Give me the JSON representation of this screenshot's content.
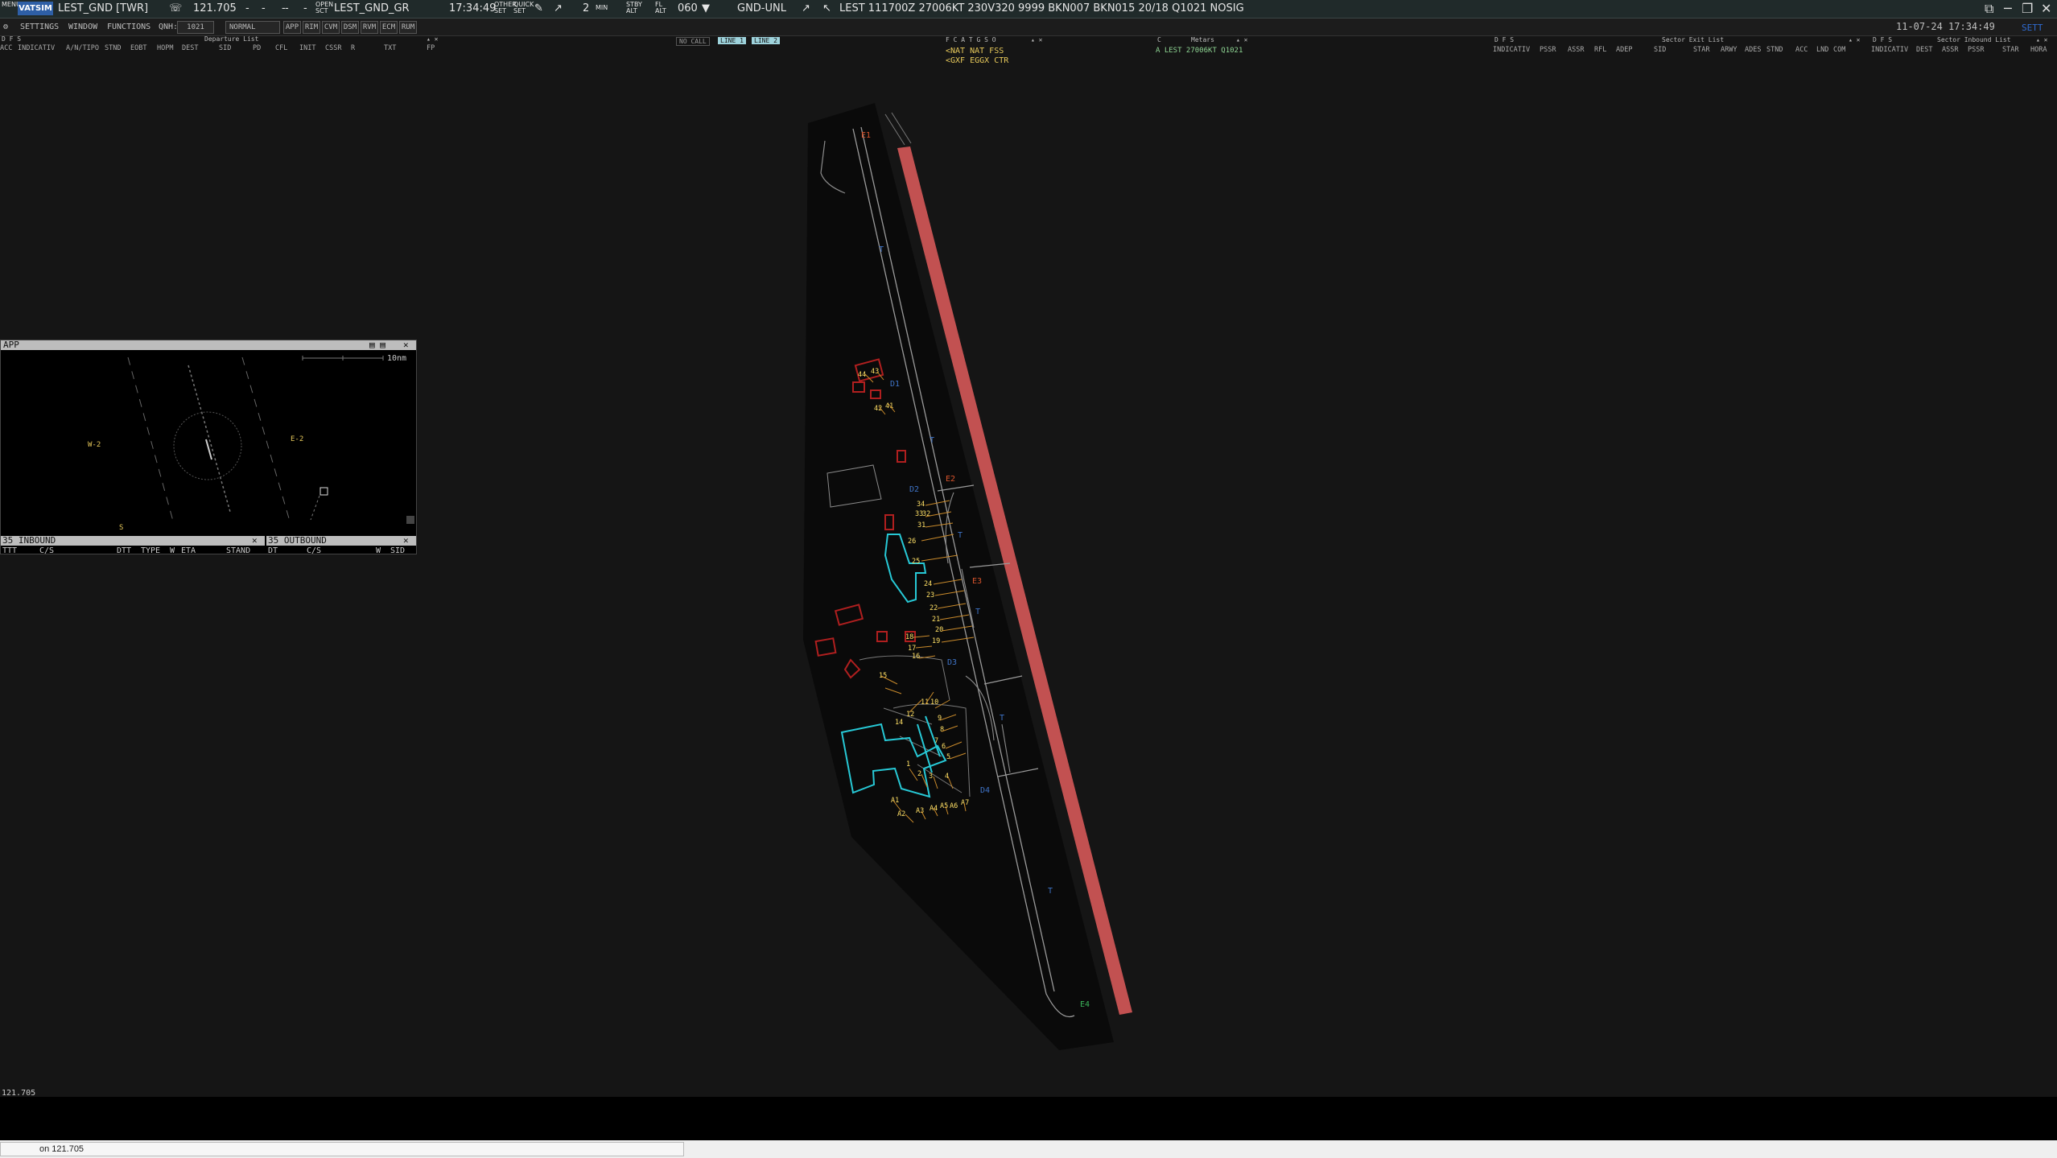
{
  "topbar": {
    "menu_label": "MENU",
    "logo": "VATSIM",
    "callsign": "LEST_GND [TWR]",
    "frequency": "121.705",
    "dashes": [
      "-",
      "-",
      "-",
      "-",
      "-"
    ],
    "open_sct": "OPEN\nSCT",
    "gr_position": "LEST_GND_GR",
    "time": "17:34:49",
    "other_set": "OTHER\nSET",
    "quick_set": "QUICK\nSET",
    "min_value": "2",
    "min_label": "MIN",
    "stby_alt": "STBY\nALT",
    "fl_alt": "FL\nALT",
    "altitude": "060",
    "gnd_unl": "GND-UNL",
    "metar": "LEST 111700Z 27006KT 230V320 9999 BKN007 BKN015 20/18 Q1021 NOSIG"
  },
  "bar2": {
    "settings": "SETTINGS",
    "window": "WINDOW",
    "functions": "FUNCTIONS",
    "qnh_label": "QNH:",
    "qnh_value": "1021",
    "mode": "NORMAL",
    "buttons": [
      "APP",
      "RIM",
      "CVM",
      "DSM",
      "RVM",
      "ECM",
      "RUM"
    ],
    "datetime": "11-07-24 17:34:49",
    "right_label": "SETT"
  },
  "departure_list": {
    "title": "Departure List",
    "flags": "D F S",
    "columns": [
      "ACC",
      "INDICATIV",
      "A/N/TIPO",
      "STND",
      "EOBT",
      "HOPM",
      "DEST",
      "SID",
      "PD",
      "CFL",
      "INIT",
      "CSSR",
      "R",
      "TXT",
      "FP"
    ]
  },
  "center_controls": {
    "no_call": "NO CALL",
    "line1": "LINE 1",
    "line2": "LINE 2",
    "atc_flags": "F C A T G S O",
    "atc_lines": [
      "<NAT NAT FSS",
      "<GXF EGGX CTR"
    ]
  },
  "metar_window": {
    "title": "Metars",
    "flag": "C",
    "line": "A LEST 27006KT Q1021"
  },
  "sector_exit_list": {
    "title": "Sector Exit List",
    "flags": "D F S",
    "columns": [
      "INDICATIV",
      "PSSR",
      "ASSR",
      "RFL",
      "ADEP",
      "SID",
      "STAR",
      "ARWY",
      "ADES",
      "STND",
      "ACC",
      "LND",
      "COM"
    ]
  },
  "sector_inbound_list": {
    "title": "Sector Inbound List",
    "flags": "D F S",
    "columns": [
      "INDICATIV",
      "DEST",
      "ASSR",
      "PSSR",
      "STAR",
      "HORA"
    ]
  },
  "app_window": {
    "title": "APP",
    "scale_label": "10nm",
    "labels": {
      "w2": "W-2",
      "e2": "E-2",
      "s": "S"
    },
    "inbound": {
      "title": "35 INBOUND",
      "columns": [
        "TTT",
        "C/S",
        "DTT",
        "TYPE",
        "W",
        "ETA",
        "STAND"
      ]
    },
    "outbound": {
      "title": "35 OUTBOUND",
      "columns": [
        "DT",
        "C/S",
        "W",
        "SID"
      ]
    }
  },
  "airport_map": {
    "taxiway_labels": [
      "E1",
      "E2",
      "E3",
      "E4"
    ],
    "blue_labels": [
      "D1",
      "D2",
      "D3",
      "D4",
      "T",
      "T",
      "T",
      "T",
      "T",
      "T"
    ],
    "stands": [
      "44",
      "43",
      "42",
      "41",
      "34",
      "33",
      "32",
      "31",
      "26",
      "25",
      "24",
      "23",
      "22",
      "21",
      "20",
      "19",
      "18",
      "17",
      "16",
      "15",
      "14",
      "12",
      "11",
      "10",
      "9",
      "8",
      "7",
      "6",
      "5",
      "4",
      "3",
      "2",
      "1",
      "A1",
      "A2",
      "A3",
      "A4",
      "A5",
      "A6",
      "A7"
    ]
  },
  "bottom": {
    "frequency_label": "121.705",
    "command_text": "on 121.705"
  },
  "colors": {
    "background": "#151515",
    "runway": "#c25151",
    "terminal": "#27c9d6",
    "stand_text": "#ffe066",
    "stand_lines": "#c98a2b",
    "building": "#b01f1f",
    "taxiway_blue": "#3f74c8",
    "exit_label": "#d9542c",
    "metar_yellow": "#e6c85a",
    "metar_green": "#8fd694"
  }
}
